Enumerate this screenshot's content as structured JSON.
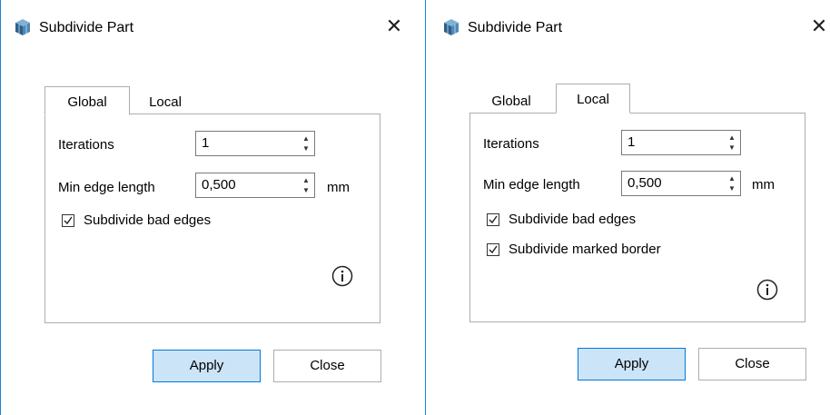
{
  "dialogs": [
    {
      "title": "Subdivide Part",
      "tabs": {
        "global": "Global",
        "local": "Local",
        "active": "Global"
      },
      "iterations": {
        "label": "Iterations",
        "value": "1"
      },
      "min_edge": {
        "label": "Min edge length",
        "value": "0,500",
        "unit": "mm"
      },
      "checkboxes": [
        {
          "label": "Subdivide bad edges",
          "checked": true
        }
      ],
      "buttons": {
        "apply": "Apply",
        "close": "Close"
      }
    },
    {
      "title": "Subdivide Part",
      "tabs": {
        "global": "Global",
        "local": "Local",
        "active": "Local"
      },
      "iterations": {
        "label": "Iterations",
        "value": "1"
      },
      "min_edge": {
        "label": "Min edge length",
        "value": "0,500",
        "unit": "mm"
      },
      "checkboxes": [
        {
          "label": "Subdivide bad edges",
          "checked": true
        },
        {
          "label": "Subdivide marked border",
          "checked": true
        }
      ],
      "buttons": {
        "apply": "Apply",
        "close": "Close"
      }
    }
  ],
  "colors": {
    "accent_border": "#1883d7",
    "primary_button_bg": "#cce4f7",
    "primary_button_border": "#0078d7"
  },
  "icons": {
    "app": "box-3d-icon",
    "close": "close-icon",
    "info": "info-icon",
    "spin_up": "spin-up-icon",
    "spin_down": "spin-down-icon",
    "check": "check-icon"
  }
}
